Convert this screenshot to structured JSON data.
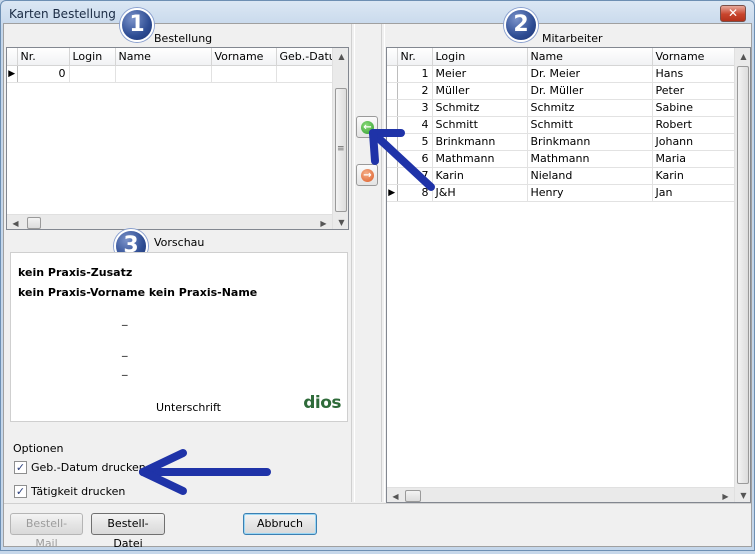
{
  "window": {
    "title": "Karten Bestellung",
    "close_label": "✕"
  },
  "bestellung": {
    "badge": "1",
    "caption": "Bestellung",
    "columns": [
      "Nr.",
      "Login",
      "Name",
      "Vorname",
      "Geb.-Datum"
    ],
    "rows": [
      {
        "nr": "0",
        "login": "",
        "name": "",
        "vorname": "",
        "geb": ""
      }
    ]
  },
  "mitarbeiter": {
    "badge": "2",
    "caption": "Mitarbeiter",
    "columns": [
      "Nr.",
      "Login",
      "Name",
      "Vorname"
    ],
    "rows": [
      {
        "nr": "1",
        "login": "Meier",
        "name": "Dr. Meier",
        "vorname": "Hans"
      },
      {
        "nr": "2",
        "login": "Müller",
        "name": "Dr. Müller",
        "vorname": "Peter"
      },
      {
        "nr": "3",
        "login": "Schmitz",
        "name": "Schmitz",
        "vorname": "Sabine"
      },
      {
        "nr": "4",
        "login": "Schmitt",
        "name": "Schmitt",
        "vorname": "Robert"
      },
      {
        "nr": "5",
        "login": "Brinkmann",
        "name": "Brinkmann",
        "vorname": "Johann"
      },
      {
        "nr": "6",
        "login": "Mathmann",
        "name": "Mathmann",
        "vorname": "Maria"
      },
      {
        "nr": "7",
        "login": "Karin",
        "name": "Nieland",
        "vorname": "Karin"
      },
      {
        "nr": "8",
        "login": "J&H",
        "name": "Henry",
        "vorname": "Jan"
      }
    ]
  },
  "vorschau": {
    "badge": "3",
    "caption": "Vorschau",
    "line1": "kein Praxis-Zusatz",
    "line2": "kein Praxis-Vorname kein Praxis-Name",
    "dash1": "_",
    "dash2": "_",
    "dash3": "_",
    "signature": "Unterschrift",
    "logo": "dios"
  },
  "optionen": {
    "label": "Optionen",
    "geb_datum": "Geb.-Datum drucken",
    "taetigkeit": "Tätigkeit drucken",
    "check_mark": "✓"
  },
  "buttons": {
    "bestell_mail": "Bestell-Mail",
    "bestell_datei": "Bestell-Datei",
    "abbruch": "Abbruch"
  },
  "icons": {
    "row_indicator": "▶",
    "move_left": "←",
    "move_right": "→",
    "scroll_left": "◀",
    "scroll_right": "▶",
    "scroll_up": "▲",
    "scroll_down": "▼",
    "grip": "≡"
  },
  "colors": {
    "move_left": "#3aa33a",
    "move_right": "#e0612d",
    "arrow": "#1f33a8"
  }
}
